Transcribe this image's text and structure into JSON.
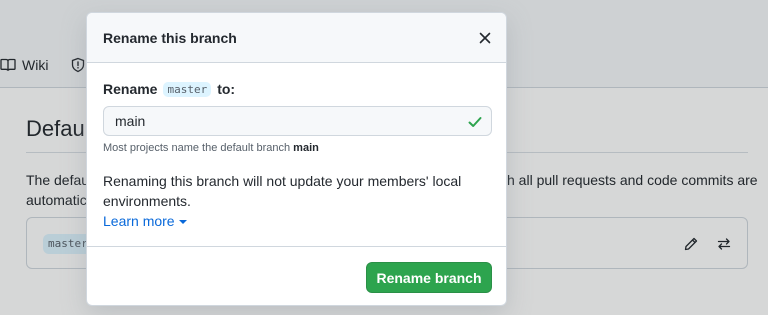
{
  "background": {
    "nav": {
      "wiki_label": "Wiki"
    },
    "heading": "Defau",
    "description_left_line1": "The defaul",
    "description_left_line2": "automatica",
    "description_right": "h all pull requests and code commits are",
    "branch_chip": "master",
    "icons": [
      "book-icon",
      "shield-icon",
      "pencil-icon",
      "arrow-switch-icon"
    ]
  },
  "dialog": {
    "title": "Rename this branch",
    "close_icon": "x-icon",
    "label_prefix": "Rename",
    "current_branch": "master",
    "label_suffix": "to:",
    "input_value": "main",
    "input_valid_icon": "check-icon",
    "note_prefix": "Most projects name the default branch",
    "note_branch": "main",
    "warning": "Renaming this branch will not update your members' local environments.",
    "learn_more": "Learn more",
    "submit_label": "Rename branch"
  },
  "colors": {
    "primary_button": "#2da44e",
    "link": "#0969da",
    "check": "#2da44e",
    "code_chip_bg": "#ddf4ff"
  }
}
